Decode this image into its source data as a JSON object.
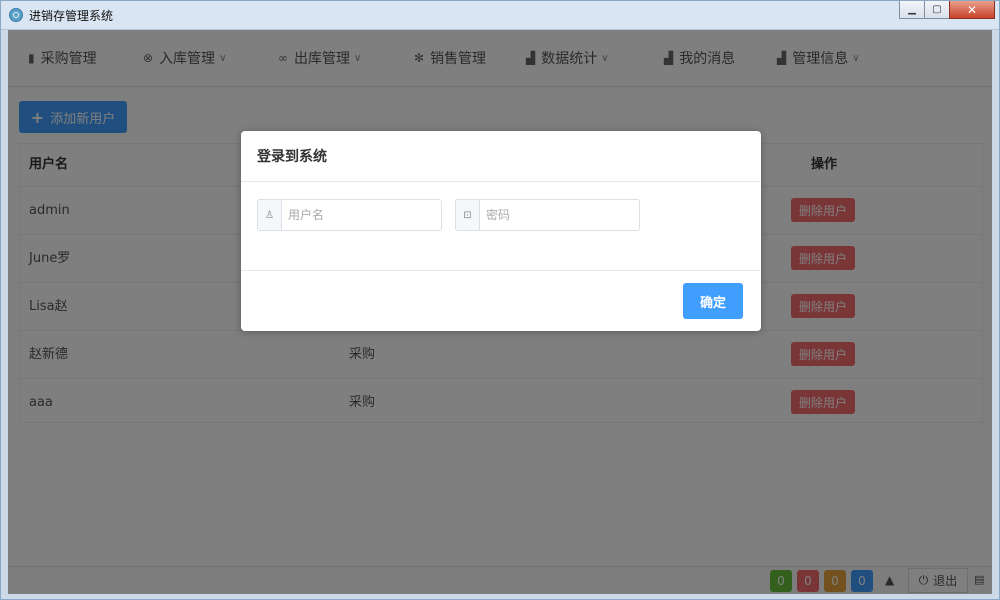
{
  "window": {
    "title": "进销存管理系统",
    "minimize_icon": "minimize-icon",
    "maximize_icon": "maximize-icon",
    "close_icon": "close-icon"
  },
  "nav": {
    "items": [
      {
        "label": "采购管理",
        "icon": "purchase-icon",
        "dropdown": false
      },
      {
        "label": "入库管理",
        "icon": "inbound-icon",
        "dropdown": true
      },
      {
        "label": "出库管理",
        "icon": "outbound-icon",
        "dropdown": true
      },
      {
        "label": "销售管理",
        "icon": "gear-icon",
        "dropdown": false
      },
      {
        "label": "数据统计",
        "icon": "bar-chart-icon",
        "dropdown": true
      },
      {
        "label": "我的消息",
        "icon": "bar-chart-icon",
        "dropdown": false
      },
      {
        "label": "管理信息",
        "icon": "bar-chart-icon",
        "dropdown": true
      }
    ]
  },
  "toolbar": {
    "add_user_label": "添加新用户",
    "add_icon": "plus-icon"
  },
  "table": {
    "headers": {
      "username": "用户名",
      "role": "",
      "actions": "操作"
    },
    "delete_label": "删除用户",
    "rows": [
      {
        "username": "admin",
        "role": ""
      },
      {
        "username": "June罗",
        "role": ""
      },
      {
        "username": "Lisa赵",
        "role": ""
      },
      {
        "username": "赵新德",
        "role": "采购"
      },
      {
        "username": "aaa",
        "role": "采购"
      }
    ]
  },
  "statusbar": {
    "badges": [
      {
        "value": "0",
        "color": "#67c23a"
      },
      {
        "value": "0",
        "color": "#f56c6c"
      },
      {
        "value": "0",
        "color": "#e6a23c"
      },
      {
        "value": "0",
        "color": "#409eff"
      }
    ],
    "logout_label": "退出",
    "user_icon": "user-icon",
    "logout_icon": "power-icon",
    "doc_icon": "document-icon"
  },
  "dialog": {
    "title": "登录到系统",
    "username_placeholder": "用户名",
    "password_placeholder": "密码",
    "username_value": "",
    "password_value": "",
    "confirm_label": "确定",
    "username_icon": "user-icon",
    "password_icon": "lock-icon"
  },
  "colors": {
    "primary": "#409eff",
    "danger": "#f56c6c",
    "overlay": "rgba(0,0,0,0.5)"
  }
}
